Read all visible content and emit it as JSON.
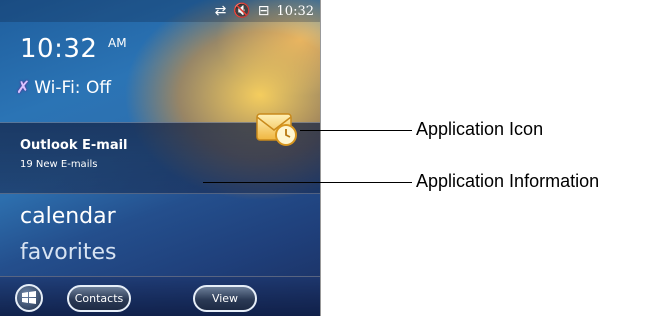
{
  "status_bar": {
    "icons": [
      "sync-arrows-icon",
      "speaker-muted-icon",
      "battery-charging-icon"
    ],
    "time": "10:32"
  },
  "home": {
    "clock_time": "10:32",
    "clock_ampm": "AM",
    "wifi_label": "Wi-Fi: Off",
    "wifi_icon": "wifi-off-icon"
  },
  "notification_panel": {
    "title": "Outlook E-mail",
    "subtitle": "19 New E-mails",
    "app_icon": "outlook-envelope-clock-icon"
  },
  "menu": {
    "items": [
      "calendar",
      "favorites"
    ]
  },
  "softkeys": {
    "start_icon": "windows-flag-icon",
    "left_label": "Contacts",
    "right_label": "View"
  },
  "callouts": [
    {
      "label": "Application Icon"
    },
    {
      "label": "Application Information"
    }
  ]
}
